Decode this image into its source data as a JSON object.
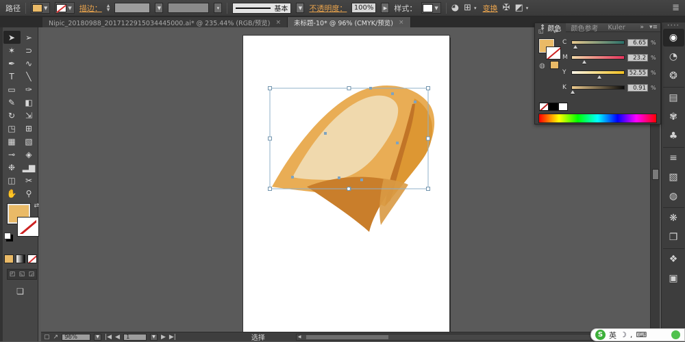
{
  "topbar": {
    "context_label": "路径",
    "stroke_label": "描边：",
    "brush_name": "基本",
    "opacity_label": "不透明度：",
    "opacity_value": "100%",
    "style_label": "样式：",
    "transform_label": "变换",
    "fill_color": "#eaba67"
  },
  "tabs": [
    {
      "title": "Nipic_20180988_2017122915034445000.ai* @ 235.44% (RGB/预览)",
      "close": "×",
      "active": false
    },
    {
      "title": "未标题-10* @ 96% (CMYK/预览)",
      "close": "×",
      "active": true
    }
  ],
  "toolbar": {
    "tools": [
      {
        "name": "selection",
        "glyph": "➤",
        "selected": true
      },
      {
        "name": "direct-selection",
        "glyph": "➢"
      },
      {
        "name": "magic-wand",
        "glyph": "✶"
      },
      {
        "name": "lasso",
        "glyph": "⊃"
      },
      {
        "name": "pen",
        "glyph": "✒"
      },
      {
        "name": "width",
        "glyph": "∿"
      },
      {
        "name": "type",
        "glyph": "T"
      },
      {
        "name": "line-segment",
        "glyph": "╲"
      },
      {
        "name": "rectangle",
        "glyph": "▭"
      },
      {
        "name": "paintbrush",
        "glyph": "✑"
      },
      {
        "name": "pencil",
        "glyph": "✎"
      },
      {
        "name": "eraser",
        "glyph": "◧"
      },
      {
        "name": "rotate",
        "glyph": "↻"
      },
      {
        "name": "scale",
        "glyph": "⇲"
      },
      {
        "name": "free-transform",
        "glyph": "◳"
      },
      {
        "name": "perspective-grid",
        "glyph": "⊞"
      },
      {
        "name": "mesh",
        "glyph": "▦"
      },
      {
        "name": "gradient",
        "glyph": "▧"
      },
      {
        "name": "eyedropper",
        "glyph": "⊸"
      },
      {
        "name": "blend",
        "glyph": "◈"
      },
      {
        "name": "symbol-sprayer",
        "glyph": "❉"
      },
      {
        "name": "column-graph",
        "glyph": "▂▆"
      },
      {
        "name": "artboard",
        "glyph": "◫"
      },
      {
        "name": "slice",
        "glyph": "✂"
      },
      {
        "name": "hand",
        "glyph": "✋"
      },
      {
        "name": "zoom",
        "glyph": "⚲"
      }
    ],
    "fill_color": "#eaba67",
    "draw_modes": [
      "◰",
      "◱",
      "◲"
    ],
    "screen_mode_glyph": "❏"
  },
  "color_panel": {
    "tabs": [
      {
        "label": "颜色",
        "active": true
      },
      {
        "label": "颜色参考",
        "active": false
      },
      {
        "label": "Kuler",
        "active": false
      }
    ],
    "collapse_icon": "»",
    "menu_icon": "▾≡",
    "channels": [
      {
        "label": "C",
        "value": "6.65",
        "pct": 6.65,
        "track": "c"
      },
      {
        "label": "M",
        "value": "23.2",
        "pct": 23.2,
        "track": "m"
      },
      {
        "label": "Y",
        "value": "52.55",
        "pct": 52.55,
        "track": "y"
      },
      {
        "label": "K",
        "value": "0.91",
        "pct": 0.91,
        "track": "k"
      }
    ],
    "percent": "%",
    "fill_color": "#eaba67"
  },
  "dock": {
    "items": [
      {
        "name": "color",
        "glyph": "◉",
        "active": true,
        "group": false
      },
      {
        "name": "color-guide",
        "glyph": "◔",
        "group": false
      },
      {
        "name": "kuler",
        "glyph": "❂",
        "group": false
      },
      {
        "name": "swatches",
        "glyph": "▤",
        "group": true
      },
      {
        "name": "brushes",
        "glyph": "✾",
        "group": false
      },
      {
        "name": "symbols",
        "glyph": "♣",
        "group": false
      },
      {
        "name": "stroke",
        "glyph": "≡",
        "group": true
      },
      {
        "name": "gradient",
        "glyph": "▧",
        "group": false
      },
      {
        "name": "transparency",
        "glyph": "◍",
        "group": false
      },
      {
        "name": "appearance",
        "glyph": "❋",
        "group": true
      },
      {
        "name": "graphic-styles",
        "glyph": "❐",
        "group": false
      },
      {
        "name": "layers",
        "glyph": "❖",
        "group": true
      },
      {
        "name": "artboards",
        "glyph": "▣",
        "group": false
      }
    ]
  },
  "statusbar": {
    "zoom_value": "96%",
    "artboard_value": "1",
    "status_text": "选择"
  },
  "ime": {
    "lang_label": "英",
    "logo_letter": "S"
  },
  "artwork": {
    "main": "#e9ad55",
    "inner": "#f0d9ad",
    "fold": "#dd9733",
    "streak": "#c17427",
    "flap": "#c97e2b",
    "flap_light": "#d99a44",
    "selection": "#8fb0c9"
  }
}
